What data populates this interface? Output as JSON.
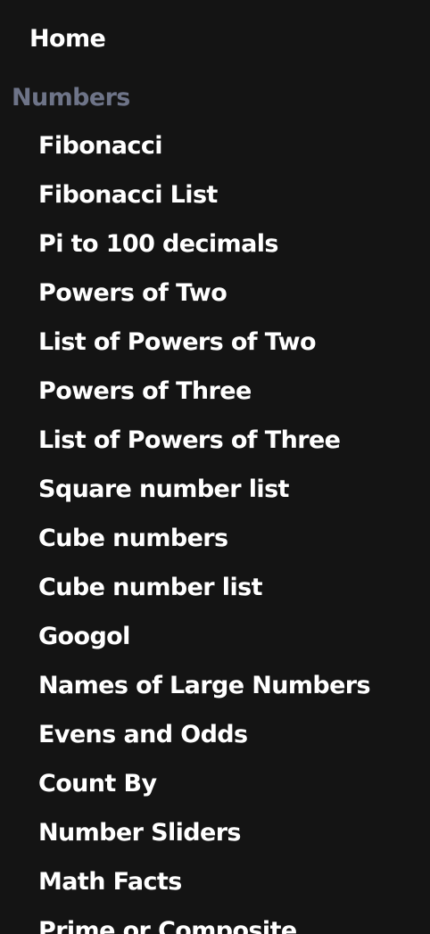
{
  "nav": {
    "home_label": "Home",
    "section_title": "Numbers",
    "items": [
      "Fibonacci",
      "Fibonacci List",
      "Pi to 100 decimals",
      "Powers of Two",
      "List of Powers of Two",
      "Powers of Three",
      "List of Powers of Three",
      "Square number list",
      "Cube numbers",
      "Cube number list",
      "Googol",
      "Names of Large Numbers",
      "Evens and Odds",
      "Count By",
      "Number Sliders",
      "Math Facts",
      "Prime or Composite"
    ]
  },
  "colors": {
    "background": "#141414",
    "text": "#ffffff",
    "section_heading": "#6e7488"
  }
}
